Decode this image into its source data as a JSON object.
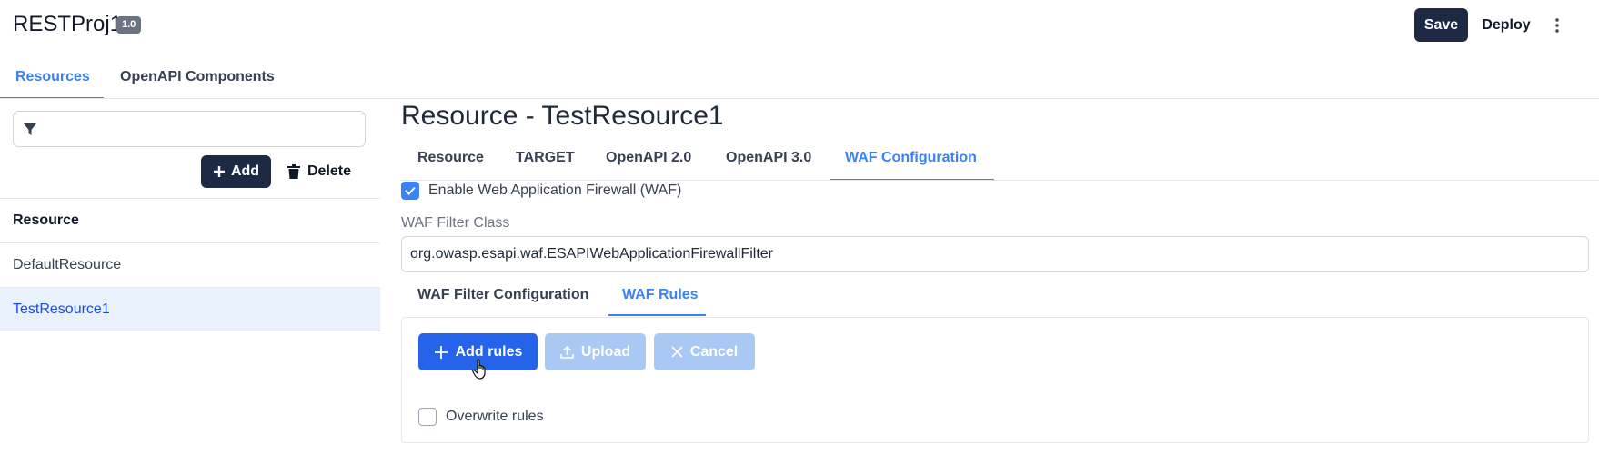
{
  "app": {
    "title": "RESTProj1",
    "version": "1.0"
  },
  "header": {
    "save_label": "Save",
    "deploy_label": "Deploy",
    "more_icon": "more-vertical-icon"
  },
  "left_tabs": [
    {
      "label": "Resources",
      "active": true
    },
    {
      "label": "OpenAPI Components",
      "active": false
    }
  ],
  "sidebar": {
    "filter": {
      "placeholder": "",
      "value": "",
      "icon": "filter-icon"
    },
    "add_label": "Add",
    "delete_label": "Delete",
    "list_header": "Resource",
    "items": [
      {
        "label": "DefaultResource",
        "selected": false
      },
      {
        "label": "TestResource1",
        "selected": true
      }
    ]
  },
  "main": {
    "title": "Resource - TestResource1",
    "tabs": [
      {
        "label": "Resource",
        "active": false
      },
      {
        "label": "TARGET",
        "active": false
      },
      {
        "label": "OpenAPI 2.0",
        "active": false
      },
      {
        "label": "OpenAPI 3.0",
        "active": false
      },
      {
        "label": "WAF Configuration",
        "active": true
      }
    ],
    "waf": {
      "enable_label": "Enable Web Application Firewall (WAF)",
      "enabled": true,
      "filter_class_label": "WAF Filter Class",
      "filter_class_value": "org.owasp.esapi.waf.ESAPIWebApplicationFirewallFilter",
      "sub_tabs": [
        {
          "label": "WAF Filter Configuration",
          "active": false
        },
        {
          "label": "WAF Rules",
          "active": true
        }
      ],
      "add_rules_label": "Add rules",
      "upload_label": "Upload",
      "cancel_label": "Cancel",
      "overwrite_label": "Overwrite rules",
      "overwrite_checked": false
    }
  },
  "colors": {
    "accent": "#3b82f6",
    "dark_button": "#1e2a45",
    "primary_button": "#2563eb",
    "disabled_button": "#a9c8f4",
    "selected_row": "#e8f1fc"
  }
}
